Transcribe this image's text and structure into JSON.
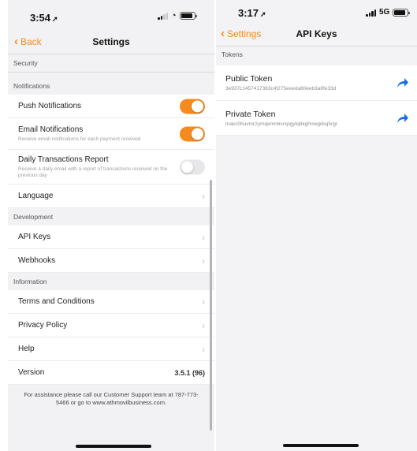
{
  "left": {
    "status": {
      "time": "3:54"
    },
    "nav": {
      "back_label": "Back",
      "title": "Settings"
    },
    "sections": {
      "security": "Security",
      "notifications": "Notifications",
      "development": "Development",
      "information": "Information"
    },
    "rows": {
      "push": {
        "label": "Push Notifications",
        "on": true
      },
      "email": {
        "label": "Email Notifications",
        "sub": "Receive email notifications for each payment received",
        "on": true
      },
      "daily": {
        "label": "Daily Transactions Report",
        "sub": "Receive a daily email with a report of transactions received on the previous day",
        "on": false
      },
      "language": "Language",
      "api_keys": "API Keys",
      "webhooks": "Webhooks",
      "terms": "Terms and Conditions",
      "privacy": "Privacy Policy",
      "help": "Help",
      "version_label": "Version",
      "version_value": "3.5.1 (96)"
    },
    "footnote": "For assistance please call our Customer Support team at 787-773-5466 or go to www.athmovilbusiness.com."
  },
  "right": {
    "status": {
      "time": "3:17",
      "network": "5G"
    },
    "nav": {
      "back_label": "Settings",
      "title": "API Keys"
    },
    "section": "Tokens",
    "tokens": [
      {
        "label": "Public Token",
        "value": "3e937c1457417363c4f275eeeda60eeb3a8fe33d"
      },
      {
        "label": "Private Token",
        "value": "makc0huvmr2ymqemn6srxpgytq6kghnwgdsq5rgr"
      }
    ]
  },
  "colors": {
    "accent": "#f58a1f",
    "share_blue": "#1a6fe0",
    "background": "#f2f2f4"
  },
  "icons": [
    "location-arrow-icon",
    "signal-icon",
    "wifi-icon",
    "battery-icon",
    "chevron-left-icon",
    "chevron-right-icon",
    "share-arrow-icon"
  ]
}
